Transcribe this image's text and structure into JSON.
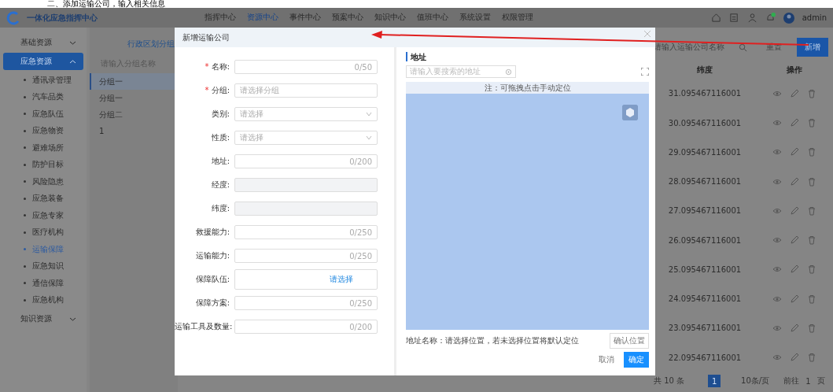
{
  "caption": "二、添加运输公司，输入相关信息",
  "header": {
    "title": "一体化应急指挥中心",
    "nav": [
      {
        "label": "指挥中心",
        "selected": false
      },
      {
        "label": "资源中心",
        "selected": true
      },
      {
        "label": "事件中心",
        "selected": false
      },
      {
        "label": "预案中心",
        "selected": false
      },
      {
        "label": "知识中心",
        "selected": false
      },
      {
        "label": "值班中心",
        "selected": false
      },
      {
        "label": "系统设置",
        "selected": false
      },
      {
        "label": "权限管理",
        "selected": false
      }
    ],
    "user": "admin"
  },
  "sidebar": {
    "items": [
      {
        "label": "基础资源",
        "selected": false,
        "expanded": false
      },
      {
        "label": "应急资源",
        "selected": true,
        "expanded": true,
        "children": [
          {
            "label": "通讯录管理",
            "selected": false
          },
          {
            "label": "汽车品类",
            "selected": false
          },
          {
            "label": "应急队伍",
            "selected": false
          },
          {
            "label": "应急物资",
            "selected": false
          },
          {
            "label": "避难场所",
            "selected": false
          },
          {
            "label": "防护目标",
            "selected": false
          },
          {
            "label": "风险隐患",
            "selected": false
          },
          {
            "label": "应急装备",
            "selected": false
          },
          {
            "label": "应急专家",
            "selected": false
          },
          {
            "label": "医疗机构",
            "selected": false
          },
          {
            "label": "运输保障",
            "selected": true
          },
          {
            "label": "应急知识",
            "selected": false
          },
          {
            "label": "通信保障",
            "selected": false
          },
          {
            "label": "应急机构",
            "selected": false
          }
        ]
      },
      {
        "label": "知识资源",
        "selected": false,
        "expanded": false
      }
    ]
  },
  "groups": {
    "title": "行政区划分组",
    "placeholder": "请输入分组名称",
    "items": [
      {
        "label": "分组一",
        "selected": true
      },
      {
        "label": "分组一",
        "selected": false
      },
      {
        "label": "分组二",
        "selected": false
      },
      {
        "label": "1",
        "selected": false
      }
    ]
  },
  "dialog": {
    "title": "新增运输公司",
    "fields": [
      {
        "label": "名称:",
        "required_mark": "*",
        "kind": "text",
        "counter": "0/50"
      },
      {
        "label": "分组:",
        "required_mark": "*",
        "kind": "text",
        "placeholder": "请选择分组"
      },
      {
        "label": "类别:",
        "kind": "select",
        "placeholder": "请选择"
      },
      {
        "label": "性质:",
        "kind": "select",
        "placeholder": "请选择"
      },
      {
        "label": "地址:",
        "kind": "text",
        "counter": "0/200"
      },
      {
        "label": "经度:",
        "kind": "disabled"
      },
      {
        "label": "纬度:",
        "kind": "disabled"
      },
      {
        "label": "救援能力:",
        "kind": "text",
        "counter": "0/250"
      },
      {
        "label": "运输能力:",
        "kind": "text",
        "counter": "0/250"
      },
      {
        "label": "保障队伍:",
        "kind": "picker",
        "link": "请选择"
      },
      {
        "label": "保障方案:",
        "kind": "text",
        "counter": "0/250"
      },
      {
        "label": "运输工具及数量:",
        "kind": "text",
        "counter": "0/200"
      }
    ],
    "map": {
      "title": "地址",
      "search_placeholder": "请输入要搜索的地址",
      "notice": "注：可拖拽点击手动定位",
      "address_label": "地址名称：请选择位置，若未选择位置将默认定位",
      "confirm_button": "确认位置"
    },
    "buttons": [
      {
        "label": "取消",
        "kind": "default"
      },
      {
        "label": "确定",
        "kind": "primary"
      }
    ]
  },
  "table": {
    "search_placeholder": "请输入运输公司名称",
    "reset_button": "重置",
    "add_button": "新增",
    "columns": [
      "纬度",
      "操作"
    ],
    "rows": [
      {
        "latitude": "31.095467116001"
      },
      {
        "latitude": "30.095467116001"
      },
      {
        "latitude": "29.095467116001"
      },
      {
        "latitude": "28.095467116001"
      },
      {
        "latitude": "27.095467116001"
      },
      {
        "latitude": "26.095467116001"
      },
      {
        "latitude": "25.095467116001"
      },
      {
        "latitude": "24.095467116001"
      },
      {
        "latitude": "23.095467116001"
      },
      {
        "latitude": "22.095467116001"
      }
    ]
  },
  "pagination": {
    "total": "共 10 条",
    "page": "1",
    "page_size": "10条/页",
    "goto_label": "前往",
    "goto_value": "1",
    "page_suffix": "页"
  }
}
